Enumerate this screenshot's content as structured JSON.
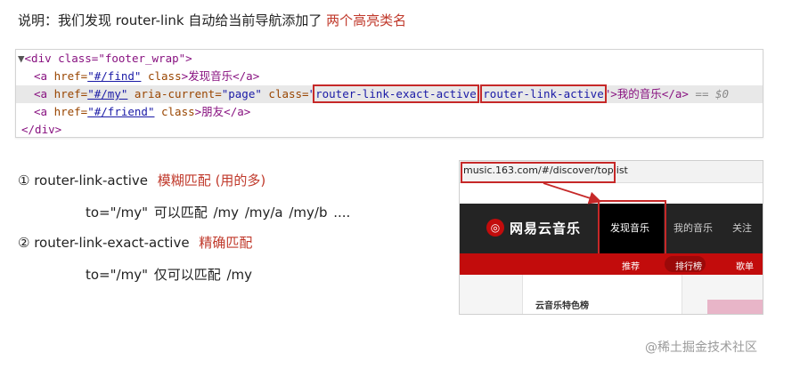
{
  "intro": {
    "text": "说明：我们发现 router-link 自动给当前导航添加了 ",
    "highlight": "两个高亮类名"
  },
  "code": {
    "line1": {
      "arrow": "▼",
      "open": "<div class=\"footer_wrap\">"
    },
    "line2": {
      "pre": "<a ",
      "href_attr": "href=",
      "href_val": "\"#/find\"",
      "class_attr": " class",
      "tail": ">发现音乐</a>"
    },
    "line3": {
      "pre": "<a ",
      "href_attr": "href=",
      "href_val": "\"#/my\"",
      "aria_attr": " aria-current=",
      "aria_val": "\"page\"",
      "class_attr": " class=",
      "quote_open": "\"",
      "class1": "router-link-exact-active",
      "class2": "router-link-active",
      "tail": "\">我的音乐</a>",
      "marker": " == $0"
    },
    "line4": {
      "pre": "<a ",
      "href_attr": "href=",
      "href_val": "\"#/friend\"",
      "class_attr": " class",
      "tail": ">朋友</a>"
    },
    "line5": {
      "close": "</div>"
    }
  },
  "items": [
    {
      "title": "① router-link-active",
      "note": "模糊匹配 (用的多)",
      "detail": "to=\"/my\"  可以匹配   /my      /my/a      /my/b     ...."
    },
    {
      "title": "② router-link-exact-active",
      "note": "精确匹配",
      "detail": "to=\"/my\"  仅可以匹配   /my"
    }
  ],
  "browser": {
    "url": "music.163.com/#/discover/toplist",
    "logo_glyph": "◎",
    "brand": "网易云音乐",
    "nav": [
      "发现音乐",
      "我的音乐",
      "关注"
    ],
    "subnav": [
      "推荐",
      "排行榜",
      "歌单"
    ],
    "panel_title": "云音乐特色榜"
  },
  "watermark": "@稀土掘金技术社区"
}
